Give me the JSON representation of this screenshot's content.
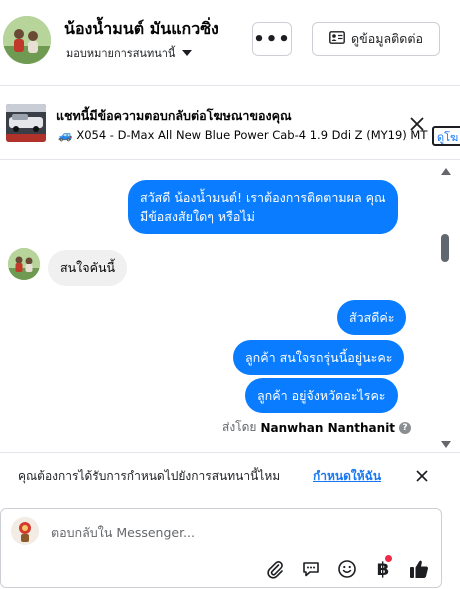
{
  "header": {
    "contact_name": "น้องน้ำมนต์ มันแกวซิ่ง",
    "assign_label": "มอบหมายการสนทนานี้",
    "more_label": "•••",
    "contact_info_label": "ดูข้อมูลติดต่อ"
  },
  "ad_banner": {
    "title": "แชทนี้มีข้อความตอบกลับต่อโฆษณาของคุณ",
    "vehicle_emoji": "🚙",
    "subtitle": "X054 - D-Max All New Blue Power Cab-4 1.9 Ddi Z (MY19) MT*...",
    "view_button": "ดูโฆ"
  },
  "conversation": {
    "messages": [
      {
        "direction": "out",
        "lines": [
          "สวัสดี น้องน้ำมนต์! เราต้องการติดตามผล คุณ",
          "มีข้อสงสัยใดๆ หรือไม่"
        ]
      },
      {
        "direction": "in",
        "text": "สนใจคันนี้"
      },
      {
        "direction": "out",
        "text": "สัวสดีค่ะ"
      },
      {
        "direction": "out",
        "text": "ลูกค้า สนใจรถรุ่นนี้อยู่นะคะ"
      },
      {
        "direction": "out",
        "text": "ลูกค้า  อยู่จังหวัดอะไรคะ"
      }
    ],
    "sent_by_prefix": "ส่งโดย",
    "sent_by_name": "Nanwhan Nanthanit",
    "help_icon": "?"
  },
  "reminder": {
    "text": "คุณต้องการได้รับการกำหนดไปยังการสนทนานี้ไหม",
    "link": "กำหนดให้ฉัน"
  },
  "composer": {
    "placeholder": "ตอบกลับใน Messenger...",
    "baht_symbol": "฿"
  },
  "colors": {
    "accent": "#0a7cff",
    "link": "#1877f2",
    "incoming_bubble": "#f0f0f0",
    "notification_dot": "#f02849"
  },
  "icons": [
    "chevron-down-icon",
    "contact-card-icon",
    "close-icon",
    "attachment-icon",
    "saved-reply-icon",
    "emoji-icon",
    "baht-icon",
    "thumbs-up-icon"
  ]
}
